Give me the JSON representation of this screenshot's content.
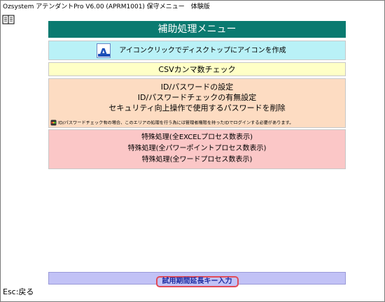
{
  "window": {
    "title": "Ozsystem アテンダントPro V6.00 (APRM1001) 保守メニュー　体験版"
  },
  "menu": {
    "header": "補助処理メニュー",
    "shortcut_label": "アイコンクリックでディスクトップにアイコンを作成",
    "csv_check": "CSVカンマ数チェック",
    "password_options": [
      "ID/パスワードの設定",
      "ID/パスワードチェックの有無設定",
      "セキュリティ向上操作で使用するパスワードを削除"
    ],
    "password_notice": "ID/パスワードチェック有の場合、このエリアの処理を行う為には管理者権限を持ったIDでログインする必要があります。",
    "special_options": [
      "特殊処理(全EXCELプロセス数表示)",
      "特殊処理(全パワーポイントプロセス数表示)",
      "特殊処理(全ワードプロセス数表示)"
    ],
    "trial_button": "試用期間延長キー入力"
  },
  "footer": {
    "esc_hint": "Esc:戻る"
  },
  "icons": {
    "top_left": "book-icon",
    "shortcut": "app-icon",
    "notice": "traffic-light-icon"
  },
  "colors": {
    "header_bg": "#0a7a70",
    "shortcut_bg": "#b9f1f7",
    "csv_bg": "#ffffc6",
    "password_bg": "#fddcc2",
    "special_bg": "#fbc7c7",
    "trial_bg": "#c2c2f6",
    "trial_border": "#e14a57"
  }
}
